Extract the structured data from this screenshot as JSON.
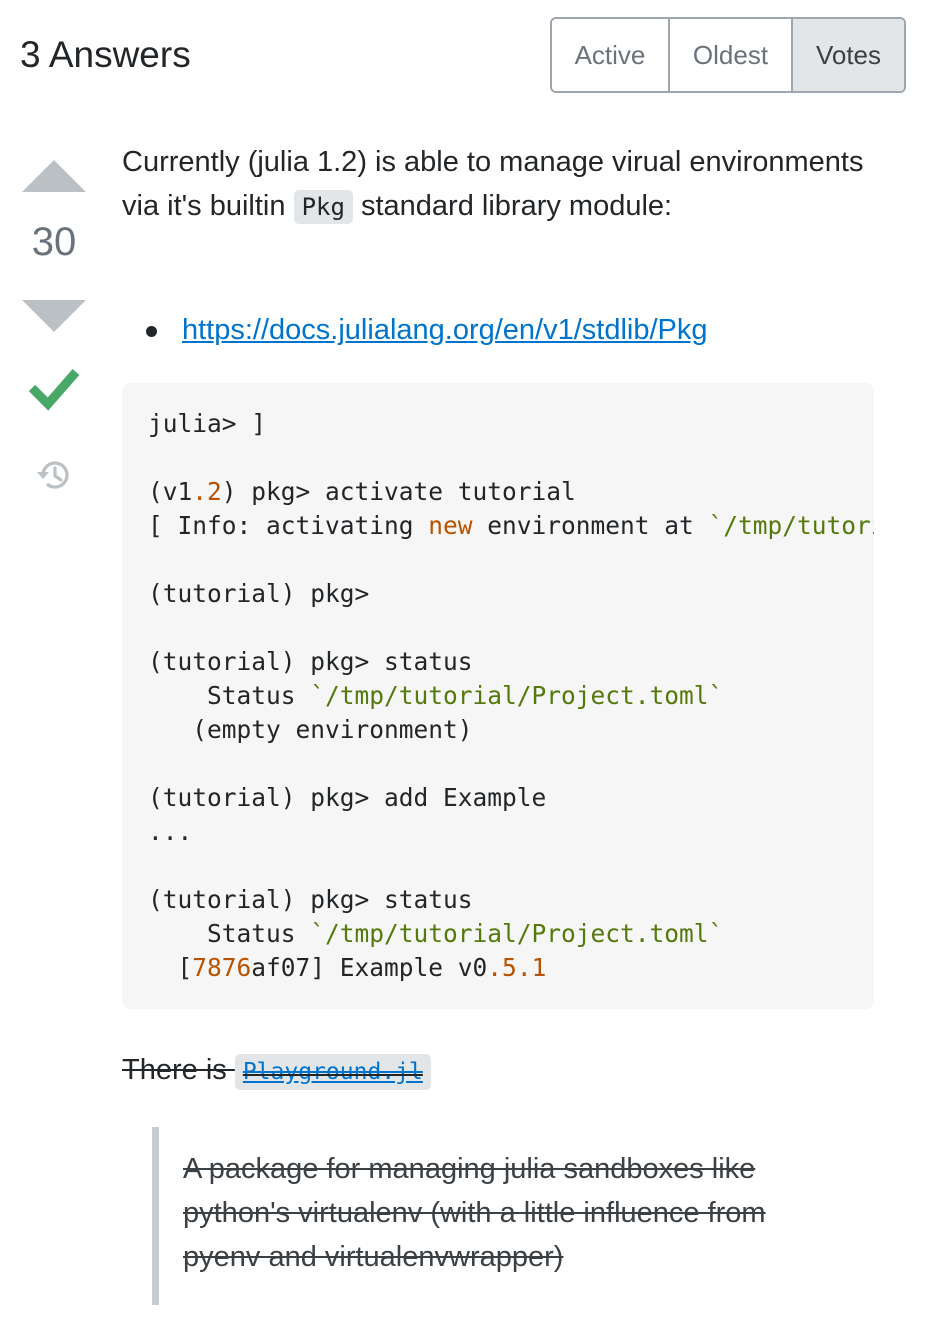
{
  "header": {
    "answers_count": "3 Answers",
    "sort_tabs": [
      "Active",
      "Oldest",
      "Votes"
    ],
    "active_tab": "Votes"
  },
  "vote": {
    "score": "30",
    "accepted": true
  },
  "post": {
    "intro_before_code": "Currently (julia 1.2) is able to manage virual environments via it's builtin ",
    "intro_code": "Pkg",
    "intro_after_code": " standard library module:",
    "link": "https://docs.julialang.org/en/v1/stdlib/Pkg",
    "code_block": {
      "l1": "julia> ]",
      "l3_a": "(v1",
      "l3_b": ".2",
      "l3_c": ") pkg> activate tutorial",
      "l4_a": "[ Info: activating ",
      "l4_b": "new",
      "l4_c": " environment at ",
      "l4_d": "`/tmp/tutorial/Project.toml`",
      "l6": "(tutorial) pkg>",
      "l8": "(tutorial) pkg> status",
      "l9_a": "    Status ",
      "l9_b": "`/tmp/tutorial/Project.toml`",
      "l10": "   (empty environment)",
      "l12": "(tutorial) pkg> add Example",
      "l13": "...",
      "l15": "(tutorial) pkg> status",
      "l16_a": "    Status ",
      "l16_b": "`/tmp/tutorial/Project.toml`",
      "l17_a": "  [",
      "l17_b": "7876",
      "l17_c": "af07] Example v0",
      "l17_d": ".5",
      "l17_e": ".1"
    },
    "struck_text": "There is ",
    "struck_code": "Playground.jl",
    "quote": "A package for managing julia sandboxes like python's virtualenv (with a little influence from pyenv and virtualenvwrapper)"
  },
  "colors": {
    "accent_link": "#0074cc",
    "accepted_green": "#48a868",
    "code_number": "#b75301",
    "code_string": "#54790d"
  },
  "icons": [
    "vote-up-icon",
    "vote-down-icon",
    "accepted-check-icon",
    "history-icon"
  ]
}
